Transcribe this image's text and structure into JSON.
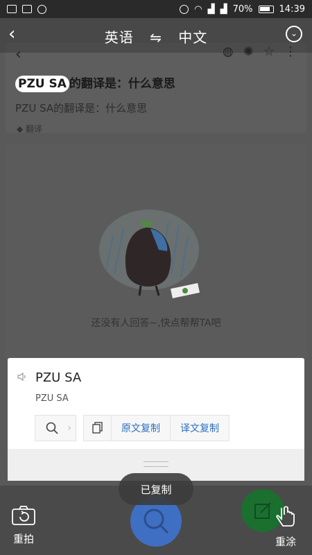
{
  "status_bar": {
    "battery_percent": "70%",
    "time": "14:39"
  },
  "translate_bar": {
    "source_lang": "英语",
    "swap_symbol": "⇋",
    "target_lang": "中文"
  },
  "background": {
    "highlight": "PZU SA",
    "title_rest": "的翻译是：什么意思",
    "subtitle": "PZU SA的翻译是：什么意思",
    "tag": "翻译",
    "empty_message": "还没有人回答~,快点帮帮TA吧"
  },
  "panel": {
    "source_text": "PZU SA",
    "translated_text": "PZU SA",
    "copy_original_label": "原文复制",
    "copy_translation_label": "译文复制"
  },
  "toast": {
    "text": "已复制"
  },
  "bottom_bar": {
    "retake_label": "重拍",
    "clear_label": "重涂"
  },
  "colors": {
    "accent_blue": "#2c6fc0",
    "fab_blue": "#3f6fc2",
    "fab_green": "#1b6f2f"
  }
}
